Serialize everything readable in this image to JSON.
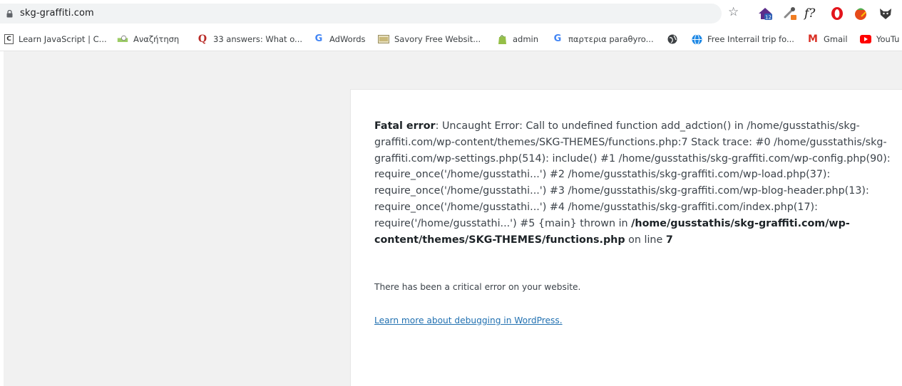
{
  "browser": {
    "url": "skg-graffiti.com",
    "extensions": [
      {
        "icon": "house-extension-icon",
        "badge": "12"
      },
      {
        "icon": "eyedropper-extension-icon"
      },
      {
        "icon": "f-extension-icon",
        "label": "f?"
      },
      {
        "icon": "opera-extension-icon"
      },
      {
        "icon": "tomato-extension-icon"
      },
      {
        "icon": "fox-extension-icon"
      }
    ]
  },
  "bookmarks": [
    {
      "icon": "c-doc-icon",
      "label": "Learn JavaScript | C..."
    },
    {
      "icon": "search-engine-icon",
      "label": "Αναζήτηση"
    },
    {
      "icon": "quora-icon",
      "label": "33 answers: What o..."
    },
    {
      "icon": "google-icon",
      "label": "AdWords"
    },
    {
      "icon": "image-icon",
      "label": "Savory Free Websit..."
    },
    {
      "icon": "shopify-icon",
      "label": "admin"
    },
    {
      "icon": "google-icon",
      "label": "παρτερια paraθyro..."
    },
    {
      "icon": "globe-icon",
      "label": ""
    },
    {
      "icon": "globe-blue-icon",
      "label": "Free Interrail trip fo..."
    },
    {
      "icon": "gmail-icon",
      "label": "Gmail"
    },
    {
      "icon": "youtube-icon",
      "label": "YouTu"
    }
  ],
  "error": {
    "label": "Fatal error",
    "message": ": Uncaught Error: Call to undefined function add_adction() in /home/gusstathis/skg-graffiti.com/wp-content/themes/SKG-THEMES/functions.php:7 Stack trace: #0 /home/gusstathis/skg-graffiti.com/wp-settings.php(514): include() #1 /home/gusstathis/skg-graffiti.com/wp-config.php(90): require_once('/home/gusstathi...') #2 /home/gusstathis/skg-graffiti.com/wp-load.php(37): require_once('/home/gusstathi...') #3 /home/gusstathis/skg-graffiti.com/wp-blog-header.php(13): require_once('/home/gusstathi...') #4 /home/gusstathis/skg-graffiti.com/index.php(17): require('/home/gusstathi...') #5 {main} thrown in",
    "file": "/home/gusstathis/skg-graffiti.com/wp-content/themes/SKG-THEMES/functions.php",
    "on_line_text": " on line ",
    "line": "7"
  },
  "critical_text": "There has been a critical error on your website.",
  "learn_more_link": "Learn more about debugging in WordPress.",
  "colors": {
    "link": "#2271b1",
    "text": "#3c434a",
    "page_background": "#f1f1f1",
    "panel_background": "#ffffff"
  }
}
